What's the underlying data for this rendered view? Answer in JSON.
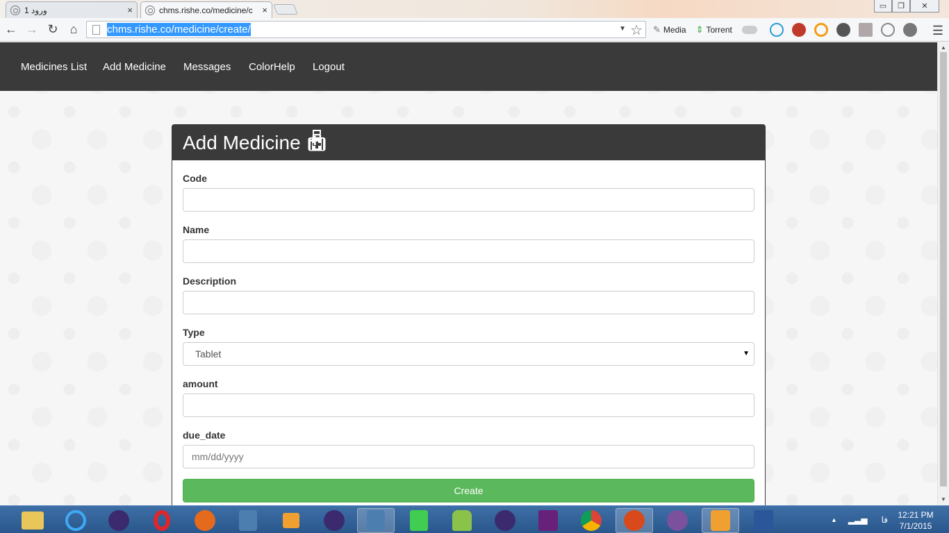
{
  "browser": {
    "tabs": [
      {
        "title": "ورود 1",
        "close": "×",
        "active": false
      },
      {
        "title": "chms.rishe.co/medicine/c",
        "close": "×",
        "active": true
      }
    ],
    "url": "chms.rishe.co/medicine/create/",
    "extensions": {
      "media_label": "Media",
      "torrent_label": "Torrent"
    },
    "window_controls": {
      "minimize": "▭",
      "maximize": "❐",
      "close": "✕"
    }
  },
  "site_nav": {
    "items": [
      "Medicines List",
      "Add Medicine",
      "Messages",
      "ColorHelp",
      "Logout"
    ]
  },
  "form": {
    "title": "Add Medicine",
    "fields": {
      "code": {
        "label": "Code",
        "value": ""
      },
      "name": {
        "label": "Name",
        "value": ""
      },
      "description": {
        "label": "Description",
        "value": ""
      },
      "type": {
        "label": "Type",
        "selected": "Tablet"
      },
      "amount": {
        "label": "amount",
        "value": ""
      },
      "due_date": {
        "label": "due_date",
        "placeholder": "mm/dd/yyyy"
      }
    },
    "submit_label": "Create"
  },
  "taskbar": {
    "clock_time": "12:21 PM",
    "clock_date": "7/1/2015",
    "lang": "فا"
  },
  "colors": {
    "nav_bg": "#3a3a3a",
    "button_green": "#5cb85c",
    "taskbar_blue": "#2a578c"
  }
}
